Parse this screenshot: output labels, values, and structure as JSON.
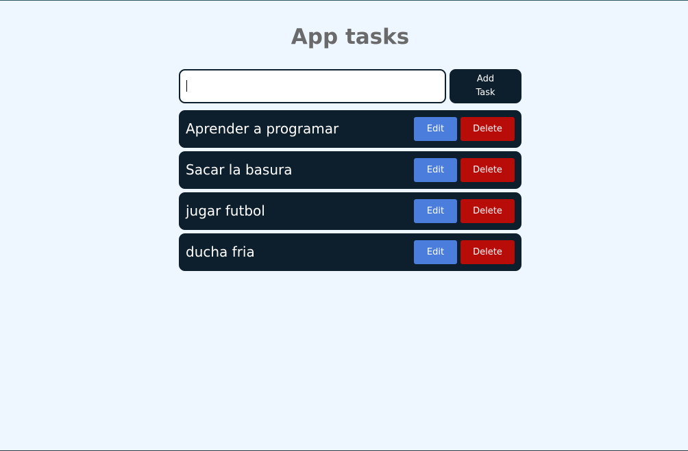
{
  "header": {
    "title": "App tasks"
  },
  "form": {
    "input_value": "",
    "placeholder": "",
    "add_label_line1": "Add",
    "add_label_line2": "Task"
  },
  "tasks": [
    {
      "text": "Aprender a programar",
      "edit_label": "Edit",
      "delete_label": "Delete"
    },
    {
      "text": "Sacar la basura",
      "edit_label": "Edit",
      "delete_label": "Delete"
    },
    {
      "text": "jugar futbol",
      "edit_label": "Edit",
      "delete_label": "Delete"
    },
    {
      "text": "ducha fria",
      "edit_label": "Edit",
      "delete_label": "Delete"
    }
  ],
  "colors": {
    "background": "#eef6ff",
    "card": "#0d1e2c",
    "edit": "#4a7ddc",
    "delete": "#b80c09",
    "title": "#6a6a6a"
  }
}
